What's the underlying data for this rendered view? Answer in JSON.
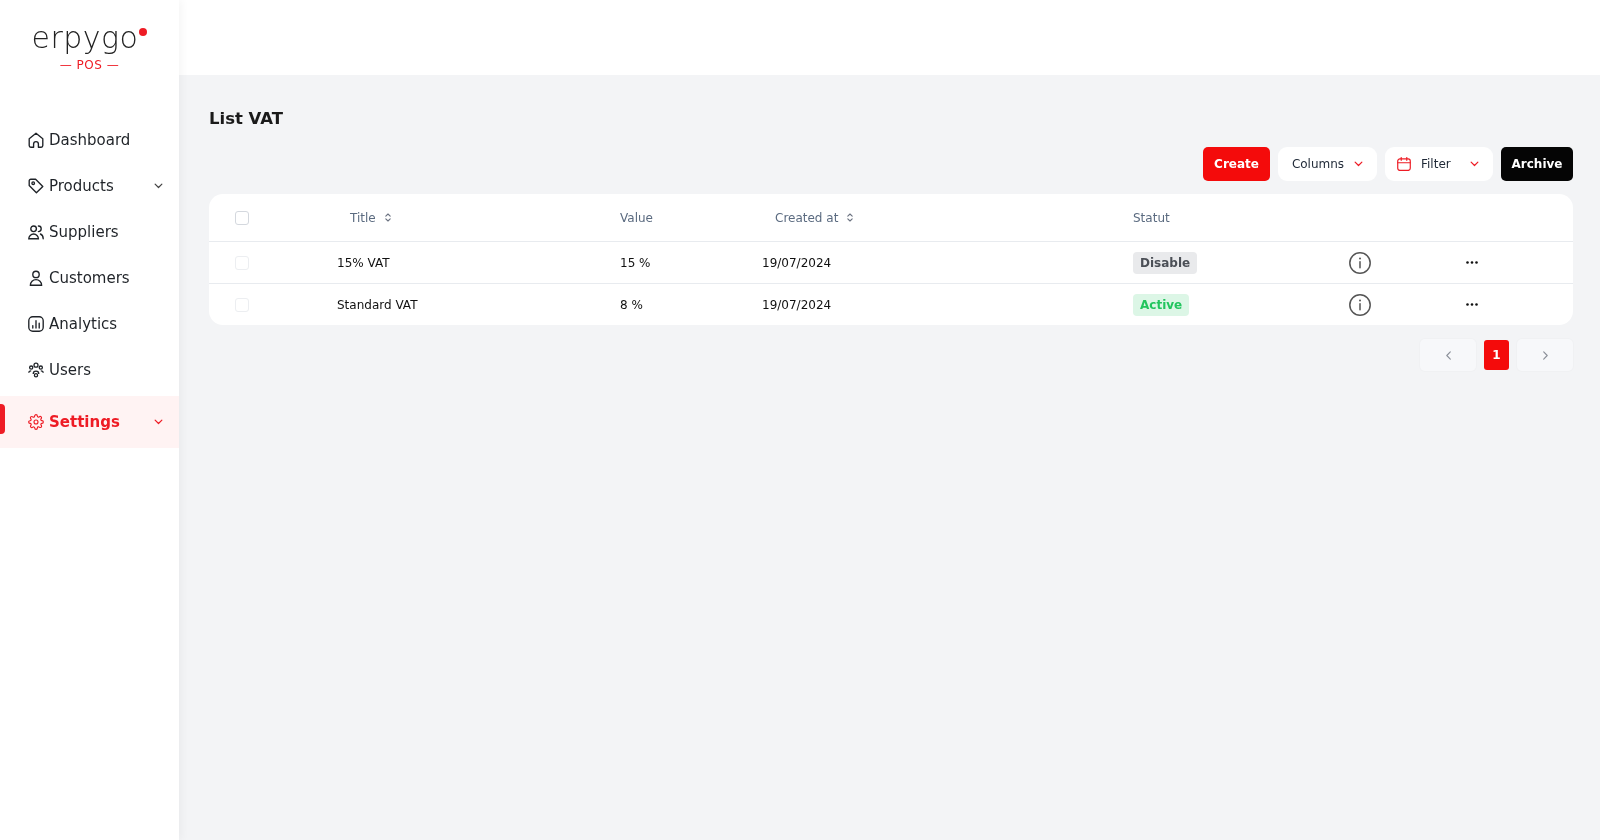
{
  "logo": {
    "wordmark": "erpygo",
    "subtitle": "— POS —"
  },
  "sidebar": {
    "items": [
      {
        "label": "Dashboard",
        "selected": false,
        "has_submenu": false
      },
      {
        "label": "Products",
        "selected": false,
        "has_submenu": true
      },
      {
        "label": "Suppliers",
        "selected": false,
        "has_submenu": false
      },
      {
        "label": "Customers",
        "selected": false,
        "has_submenu": false
      },
      {
        "label": "Analytics",
        "selected": false,
        "has_submenu": false
      },
      {
        "label": "Users",
        "selected": false,
        "has_submenu": false
      },
      {
        "label": "Settings",
        "selected": true,
        "has_submenu": true
      }
    ]
  },
  "page": {
    "title": "List VAT"
  },
  "toolbar": {
    "buttons": [
      {
        "kind": "primary",
        "label": "Create"
      },
      {
        "kind": "dropdown",
        "label": "Columns"
      },
      {
        "kind": "filter",
        "label": "Filter"
      },
      {
        "kind": "dark",
        "label": "Archive"
      }
    ]
  },
  "table": {
    "select_all": {
      "checked": false
    },
    "columns": [
      {
        "label": "Title",
        "sortable": true
      },
      {
        "label": "Value",
        "sortable": false
      },
      {
        "label": "Created at",
        "sortable": true
      },
      {
        "label": "Statut",
        "sortable": false
      }
    ],
    "rows": [
      {
        "checked": false,
        "title": "15% VAT",
        "value": "15 %",
        "created_at": "19/07/2024",
        "status": {
          "kind": "disabled",
          "label": "Disable"
        }
      },
      {
        "checked": false,
        "title": "Standard VAT",
        "value": "8 %",
        "created_at": "19/07/2024",
        "status": {
          "kind": "active",
          "label": "Active"
        }
      }
    ]
  },
  "pagination": {
    "pages": [
      {
        "label": "1",
        "selected": true
      }
    ]
  }
}
